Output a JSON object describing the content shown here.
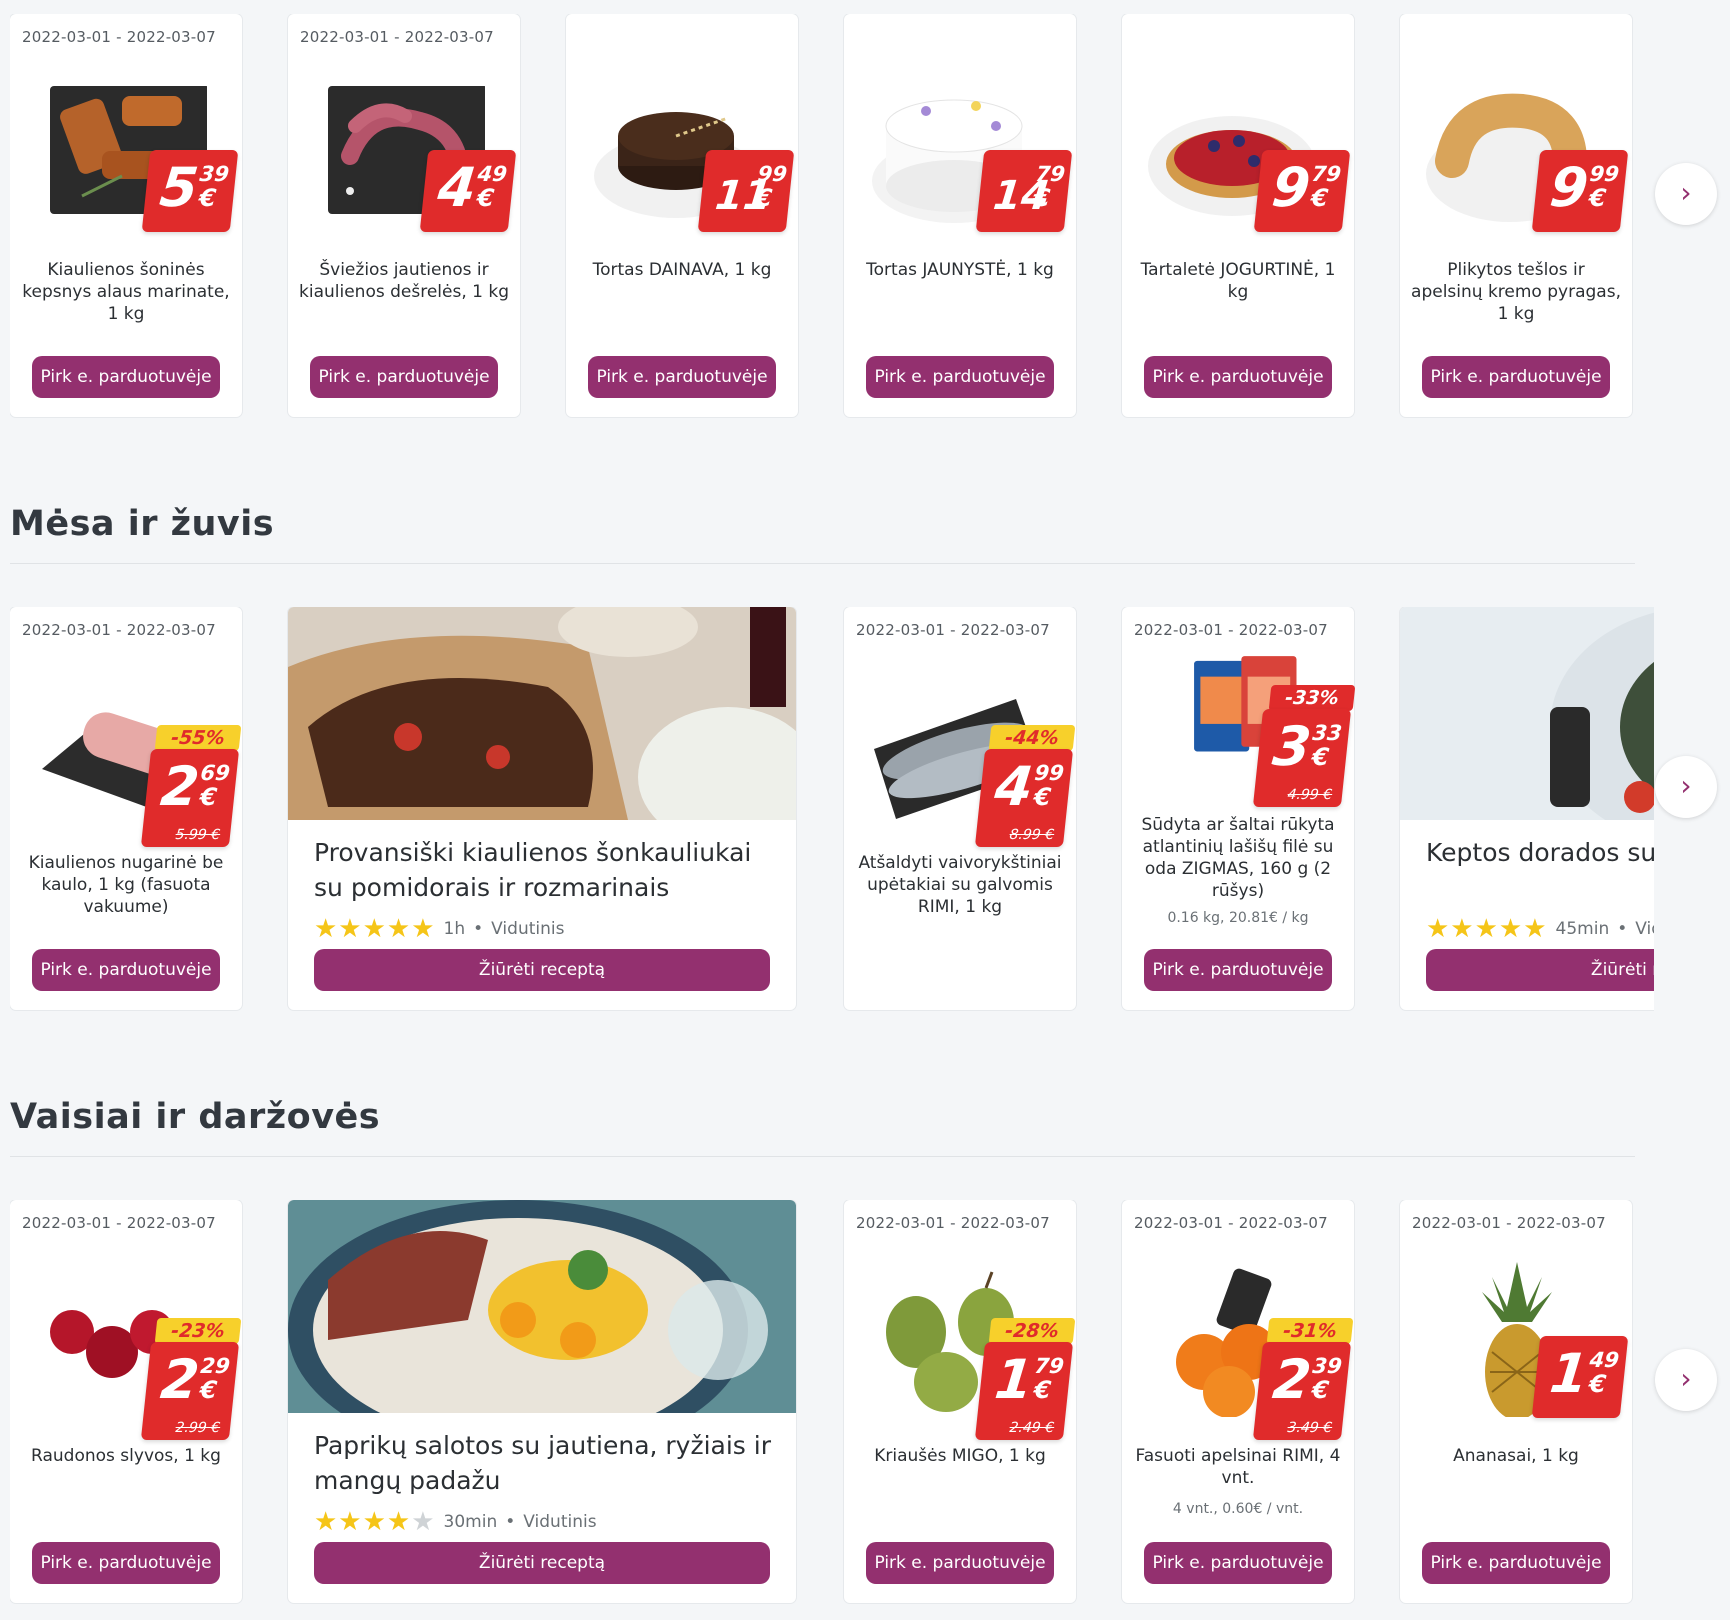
{
  "sections": [
    {
      "title": ""
    },
    {
      "title": "Mėsa ir žuvis"
    },
    {
      "title": "Vaisiai ir daržovės"
    }
  ],
  "buy_label": "Pirk e. parduotuvėje",
  "recipe_button": "Žiūrėti receptą",
  "next_icon": "chevron-right-icon",
  "row1": [
    {
      "date": "2022-03-01 - 2022-03-07",
      "name": "Kiaulienos šoninės kepsnys alaus marinate, 1 kg",
      "int": "5",
      "cents": "39",
      "cur": "€"
    },
    {
      "date": "2022-03-01 - 2022-03-07",
      "name": "Šviežios jautienos ir kiaulienos dešrelės, 1 kg",
      "int": "4",
      "cents": "49",
      "cur": "€"
    },
    {
      "date": "",
      "name": "Tortas DAINAVA, 1 kg",
      "int": "11",
      "cents": "99",
      "cur": "€"
    },
    {
      "date": "",
      "name": "Tortas JAUNYSTĖ, 1 kg",
      "int": "14",
      "cents": "79",
      "cur": "€"
    },
    {
      "date": "",
      "name": "Tartaletė JOGURTINĖ, 1 kg",
      "int": "9",
      "cents": "79",
      "cur": "€"
    },
    {
      "date": "",
      "name": "Plikytos tešlos ir apelsinų kremo pyragas, 1 kg",
      "int": "9",
      "cents": "99",
      "cur": "€"
    }
  ],
  "row2": {
    "p1": {
      "date": "2022-03-01 - 2022-03-07",
      "name": "Kiaulienos nugarinė be kaulo, 1 kg (fasuota vakuume)",
      "disc": "-55%",
      "int": "2",
      "cents": "69",
      "cur": "€",
      "old": "5.99 €"
    },
    "recipe1": {
      "title": "Provansiški kiaulienos šonkauliukai su pomidorais ir rozmarinais",
      "time": "1h",
      "level": "Vidutinis",
      "rating": 5
    },
    "p2": {
      "date": "2022-03-01 - 2022-03-07",
      "name": "Atšaldyti vaivorykštiniai upėtakiai su galvomis RIMI, 1 kg",
      "disc": "-44%",
      "int": "4",
      "cents": "99",
      "cur": "€",
      "old": "8.99 €"
    },
    "p3": {
      "date": "2022-03-01 - 2022-03-07",
      "name": "Sūdyta ar šaltai rūkyta atlantinių lašišų filė su oda ZIGMAS, 160 g (2 rūšys)",
      "unit": "0.16 kg, 20.81€ / kg",
      "disc": "-33%",
      "int": "3",
      "cents": "33",
      "cur": "€",
      "old": "4.99 €"
    },
    "recipe2": {
      "title": "Keptos dorados su pomidorais",
      "time": "45min",
      "level": "Vidutinis",
      "rating": 5
    }
  },
  "row3": {
    "p1": {
      "date": "2022-03-01 - 2022-03-07",
      "name": "Raudonos slyvos, 1 kg",
      "disc": "-23%",
      "int": "2",
      "cents": "29",
      "cur": "€",
      "old": "2.99 €"
    },
    "recipe1": {
      "title": "Paprikų salotos su jautiena, ryžiais ir mangų padažu",
      "time": "30min",
      "level": "Vidutinis",
      "rating": 4
    },
    "p2": {
      "date": "2022-03-01 - 2022-03-07",
      "name": "Kriaušės MIGO, 1 kg",
      "disc": "-28%",
      "int": "1",
      "cents": "79",
      "cur": "€",
      "old": "2.49 €"
    },
    "p3": {
      "date": "2022-03-01 - 2022-03-07",
      "name": "Fasuoti apelsinai RIMI, 4 vnt.",
      "unit": "4 vnt., 0.60€ / vnt.",
      "disc": "-31%",
      "int": "2",
      "cents": "39",
      "cur": "€",
      "old": "3.49 €"
    },
    "p4": {
      "date": "2022-03-01 - 2022-03-07",
      "name": "Ananasai, 1 kg",
      "int": "1",
      "cents": "49",
      "cur": "€"
    }
  }
}
